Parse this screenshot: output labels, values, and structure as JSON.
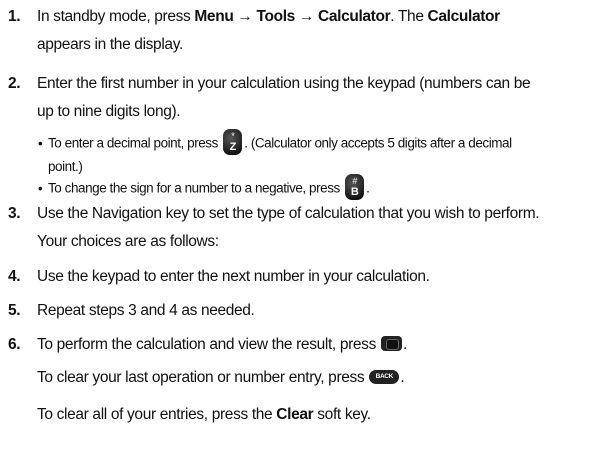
{
  "steps": {
    "s1": {
      "number": "1.",
      "line1": {
        "a": "In standby mode, press ",
        "b": "Menu → Tools → Calculator",
        "c": ". The ",
        "d": "Calculator"
      },
      "line2": "appears in the display."
    },
    "s2": {
      "number": "2.",
      "line1": "Enter the first number in your calculation using the keypad (numbers can be",
      "line2": "up to nine digits long)."
    },
    "s2_bullets": {
      "b1": {
        "text": "To enter a decimal point, press",
        "after": ". (Calculator only accepts 5 digits after a decimal",
        "cont": "point.)"
      },
      "b2": {
        "text": "To change the sign for a number to a negative, press",
        "after": "."
      }
    },
    "s3": {
      "number": "3.",
      "line1": "Use the Navigation key to set the type of calculation that you wish to perform.",
      "line2": "Your choices are as follows:"
    },
    "s4": {
      "number": "4.",
      "line1": "Use the keypad to enter the next number in your calculation."
    },
    "s5": {
      "number": "5.",
      "line1": "Repeat steps 3 and 4 as needed."
    },
    "s6": {
      "number": "6.",
      "line1": "To perform the calculation and view the result, press",
      "after": "."
    },
    "s6_extra": {
      "clear_last": "To clear your last operation or number entry, press",
      "clear_last_after": ".",
      "clear_all": {
        "a": "To clear all of your entries, press the ",
        "b": "Clear",
        "c": " soft key."
      }
    }
  },
  "keys": {
    "star": {
      "top": "*",
      "bottom": "Z"
    },
    "hash": {
      "top": "#",
      "bottom": "B"
    },
    "back_label": "BACK"
  },
  "icons": [
    "star-z-key-icon",
    "hash-b-key-icon",
    "ok-key-icon",
    "back-key-icon"
  ]
}
